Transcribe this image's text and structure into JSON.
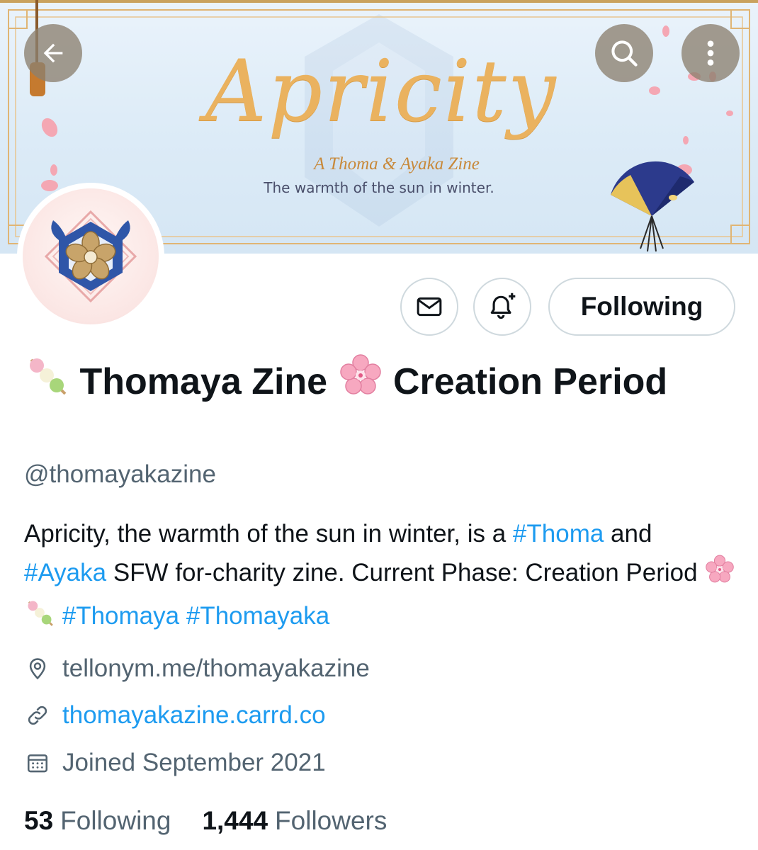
{
  "banner": {
    "title": "Apricity",
    "subtitle": "A Thoma & Ayaka Zine",
    "tagline": "The warmth of the sun in winter."
  },
  "nav": {
    "back_icon": "arrow-left-icon",
    "search_icon": "search-icon",
    "more_icon": "more-vertical-icon"
  },
  "actions": {
    "message_icon": "envelope-icon",
    "notify_icon": "bell-plus-icon",
    "following_label": "Following"
  },
  "profile": {
    "name_part1": "Thomaya Zine",
    "name_part2": "Creation Period",
    "handle": "@thomayakazine",
    "bio": {
      "text1": "Apricity, the warmth of the sun in winter, is a ",
      "tag_thoma": "#Thoma",
      "text2": " and ",
      "tag_ayaka": "#Ayaka",
      "text3": " SFW for-charity zine. Current Phase: Creation Period ",
      "tag_thomaya": "#Thomaya",
      "tag_thomayaka": "#Thomayaka"
    },
    "location": "tellonym.me/thomayakazine",
    "website": "thomayakazine.carrd.co",
    "joined": "Joined September 2021"
  },
  "stats": {
    "following_count": "53",
    "following_label": "Following",
    "followers_count": "1,444",
    "followers_label": "Followers"
  },
  "colors": {
    "link": "#1d9bf0",
    "secondary_text": "#536471",
    "border": "#cfd9de",
    "banner_gold": "#eab25f"
  }
}
